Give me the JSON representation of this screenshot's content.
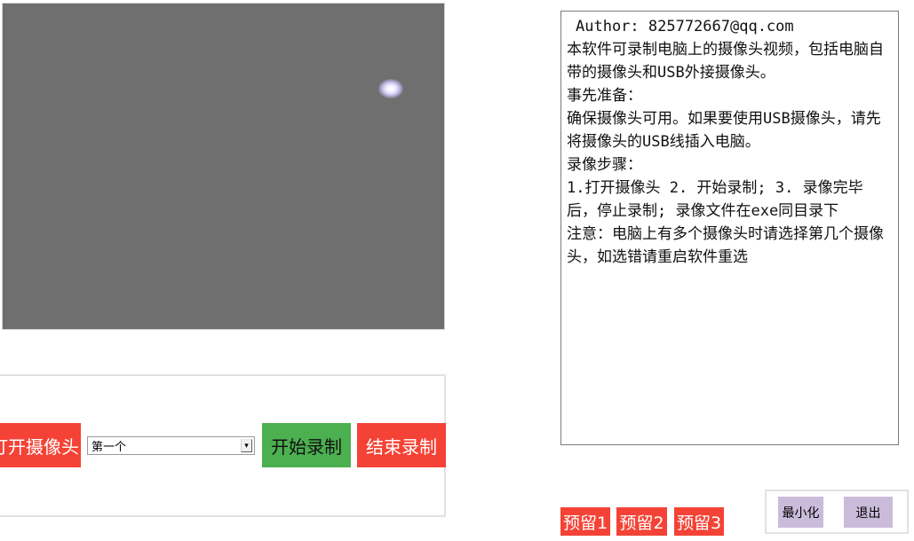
{
  "video": {
    "background_color": "#6f6f6f",
    "highlight_color": "#ffffff"
  },
  "controls": {
    "open_camera_label": "打开摄像头",
    "camera_select_value": "第一个",
    "start_record_label": "开始录制",
    "stop_record_label": "结束录制"
  },
  "info": {
    "author": "Author: 825772667@qq.com",
    "text": "本软件可录制电脑上的摄像头视频，包括电脑自带的摄像头和USB外接摄像头。\n事先准备：\n确保摄像头可用。如果要使用USB摄像头，请先将摄像头的USB线插入电脑。\n录像步骤：\n1.打开摄像头 2. 开始录制; 3. 录像完毕后，停止录制; 录像文件在exe同目录下\n注意：电脑上有多个摄像头时请选择第几个摄像头，如选错请重启软件重选"
  },
  "reserve_buttons": [
    "预留1",
    "预留2",
    "预留3"
  ],
  "window": {
    "minimize_label": "最小化",
    "exit_label": "退出"
  },
  "colors": {
    "red": "#f44336",
    "green": "#4caf50",
    "purple": "#cbbbdb"
  }
}
